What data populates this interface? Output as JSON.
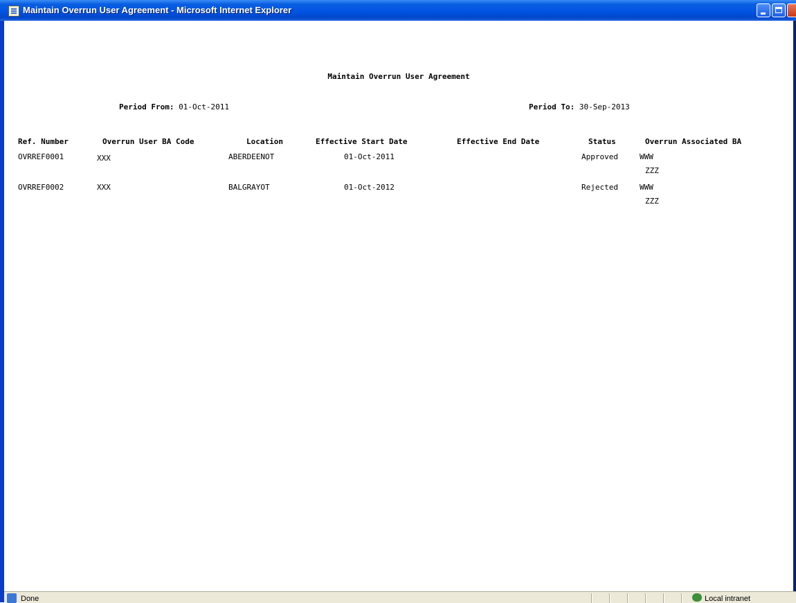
{
  "window": {
    "title": "Maintain Overrun User Agreement - Microsoft Internet Explorer"
  },
  "page": {
    "title": "Maintain Overrun User Agreement",
    "period_from_label": "Period From:",
    "period_from_value": "01-Oct-2011",
    "period_to_label": "Period To:",
    "period_to_value": "30-Sep-2013"
  },
  "table": {
    "headers": [
      "Ref. Number",
      "Overrun User BA Code",
      "Location",
      "Effective Start Date",
      "Effective End Date",
      "Status",
      "Overrun Associated BA"
    ],
    "rows": [
      {
        "ref": "OVRREF0001",
        "ba_code": "XXX",
        "location": "ABERDEENOT",
        "start": "01-Oct-2011",
        "end": "",
        "status": "Approved",
        "associated": [
          "WWW",
          "ZZZ"
        ]
      },
      {
        "ref": "OVRREF0002",
        "ba_code": "XXX",
        "location": "BALGRAYOT",
        "start": "01-Oct-2012",
        "end": "",
        "status": "Rejected",
        "associated": [
          "WWW",
          "ZZZ"
        ]
      }
    ]
  },
  "statusbar": {
    "status": "Done",
    "zone": "Local intranet"
  }
}
